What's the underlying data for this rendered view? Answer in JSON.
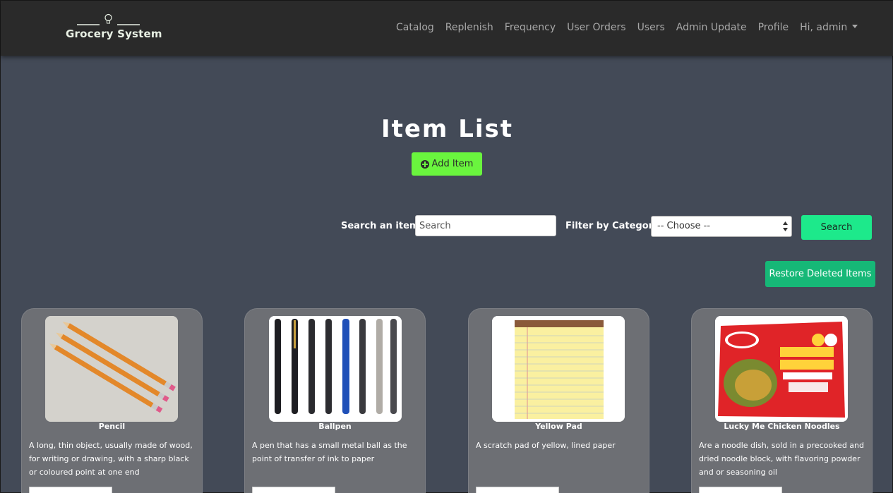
{
  "brand": {
    "name": "Grocery System"
  },
  "nav": {
    "links": [
      "Catalog",
      "Replenish",
      "Frequency",
      "User Orders",
      "Users",
      "Admin Update",
      "Profile"
    ],
    "user_menu": "Hi, admin"
  },
  "page": {
    "title": "Item List",
    "add_button": "Add Item"
  },
  "search": {
    "label": "Search an item:",
    "placeholder": "Search",
    "filter_label": "Filter by Category:",
    "filter_selected": "-- Choose --",
    "button": "Search"
  },
  "restore_button": "Restore Deleted Items",
  "items": [
    {
      "name": "Pencil",
      "description": "A long, thin object, usually made of wood, for writing or drawing, with a sharp black or coloured point at one end"
    },
    {
      "name": "Ballpen",
      "description": "A pen that has a small metal ball as the point of transfer of ink to paper"
    },
    {
      "name": "Yellow Pad",
      "description": "A scratch pad of yellow, lined paper"
    },
    {
      "name": "Lucky Me Chicken Noodles",
      "description": "Are a noodle dish, sold in a precooked and dried noodle block, with flavoring powder and or seasoning oil"
    }
  ],
  "colors": {
    "background": "#434a57",
    "navbar": "#2a2a2a",
    "add_button": "#6af53e",
    "search_button": "#1de98b",
    "restore_button": "#16b877",
    "card": "#6d6f74"
  },
  "icons": [
    "lightbulb-icon",
    "plus-circle-icon",
    "caret-down-icon",
    "select-arrows-icon"
  ]
}
